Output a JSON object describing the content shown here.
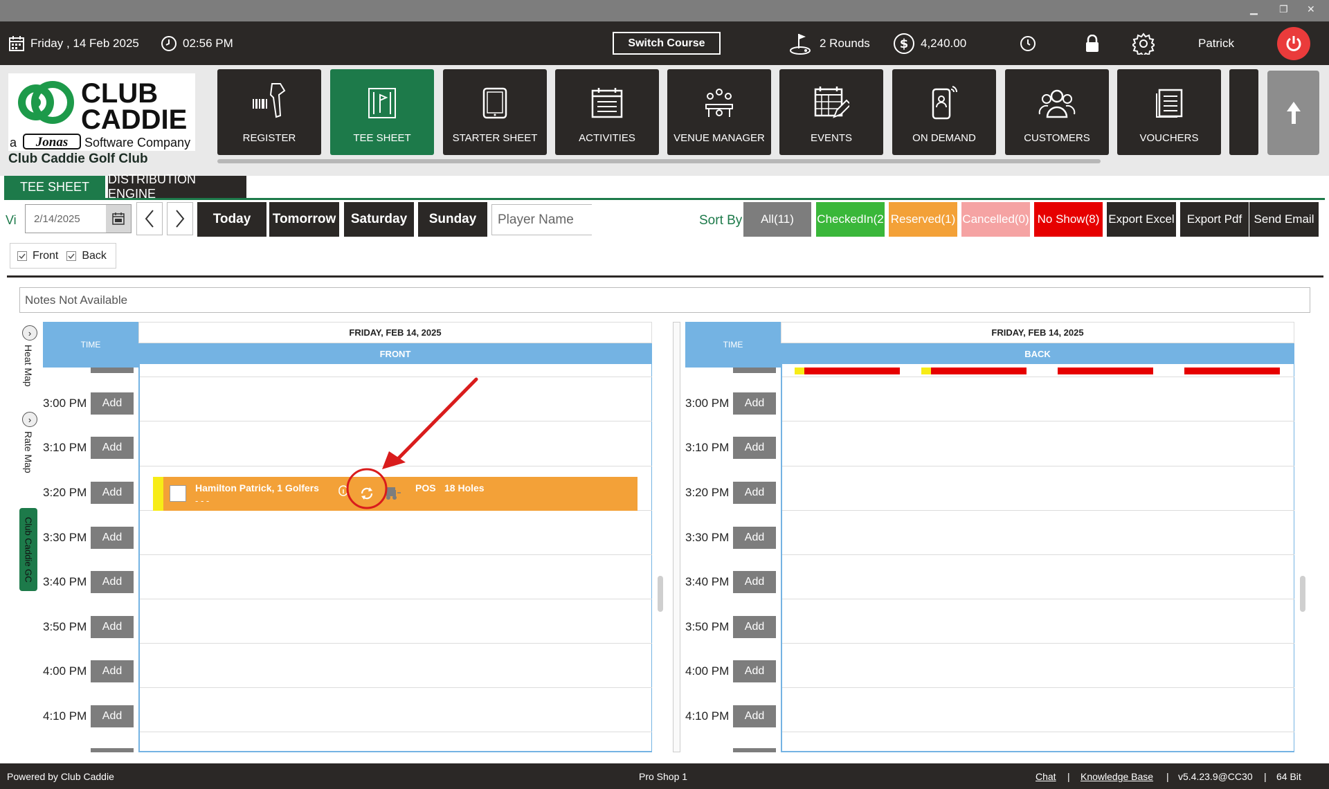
{
  "window": {
    "minimize": "▁",
    "restore": "❐",
    "close": "✕"
  },
  "topbar": {
    "date": "Friday ,  14 Feb 2025",
    "time": "02:56 PM",
    "switch_course": "Switch Course",
    "rounds": "2 Rounds",
    "balance": "4,240.00",
    "user": "Patrick"
  },
  "logo": {
    "line1": "CLUB",
    "line2": "CADDIE",
    "prefix": "a",
    "brand": "Jonas",
    "tagline": "Software Company"
  },
  "club_name": "Club Caddie Golf Club",
  "modules": [
    {
      "label": "REGISTER",
      "icon": "barcode-scanner-icon"
    },
    {
      "label": "TEE SHEET",
      "icon": "flag-sheet-icon"
    },
    {
      "label": "STARTER SHEET",
      "icon": "tablet-icon"
    },
    {
      "label": "ACTIVITIES",
      "icon": "calendar-list-icon"
    },
    {
      "label": "VENUE MANAGER",
      "icon": "meeting-table-icon"
    },
    {
      "label": "EVENTS",
      "icon": "calendar-edit-icon"
    },
    {
      "label": "ON DEMAND",
      "icon": "mobile-signal-icon"
    },
    {
      "label": "CUSTOMERS",
      "icon": "users-icon"
    },
    {
      "label": "VOUCHERS",
      "icon": "document-icon"
    }
  ],
  "tabs": {
    "tee_sheet": "TEE SHEET",
    "distribution": "DISTRIBUTION ENGINE"
  },
  "toolbar": {
    "view_label": "Vi",
    "date_value": "2/14/2025",
    "today": "Today",
    "tomorrow": "Tomorrow",
    "saturday": "Saturday",
    "sunday": "Sunday",
    "player_placeholder": "Player Name",
    "sort_by": "Sort By",
    "all": "All(11)",
    "checked_in": "CheckedIn(2",
    "reserved": "Reserved(1)",
    "cancelled": "Cancelled(0)",
    "no_show": "No Show(8)",
    "export_excel": "Export Excel",
    "export_pdf": "Export Pdf",
    "send_email": "Send Email"
  },
  "filters": {
    "front": "Front",
    "back": "Back"
  },
  "notes": "Notes Not Available",
  "side": {
    "heat_map": "Heat Map",
    "rate_map": "Rate Map",
    "club_tab": "Club Caddie GC"
  },
  "sheet": {
    "time_header": "TIME",
    "date_header": "FRIDAY, FEB 14, 2025",
    "front_label": "FRONT",
    "back_label": "BACK",
    "add_label": "Add",
    "times": [
      "3:00 PM",
      "3:10 PM",
      "3:20 PM",
      "3:30 PM",
      "3:40 PM",
      "3:50 PM",
      "4:00 PM",
      "4:10 PM"
    ]
  },
  "booking": {
    "name": "Hamilton Patrick, 1 Golfers",
    "sub": "- - -",
    "source": "POS",
    "holes": "18 Holes"
  },
  "colors": {
    "dark": "#2b2826",
    "green": "#1d7a4a",
    "blue": "#74b3e3",
    "orange": "#f3a138",
    "checked_in": "#3ab73a",
    "cancelled": "#f5a3a3",
    "no_show": "#e60000",
    "annotation": "#d91c1c"
  },
  "status": {
    "powered_by": "Powered by Club Caddie",
    "location": "Pro Shop 1",
    "chat": "Chat",
    "knowledge_base": "Knowledge Base",
    "version": "v5.4.23.9@CC30",
    "bits": "64 Bit",
    "sep": "|"
  }
}
